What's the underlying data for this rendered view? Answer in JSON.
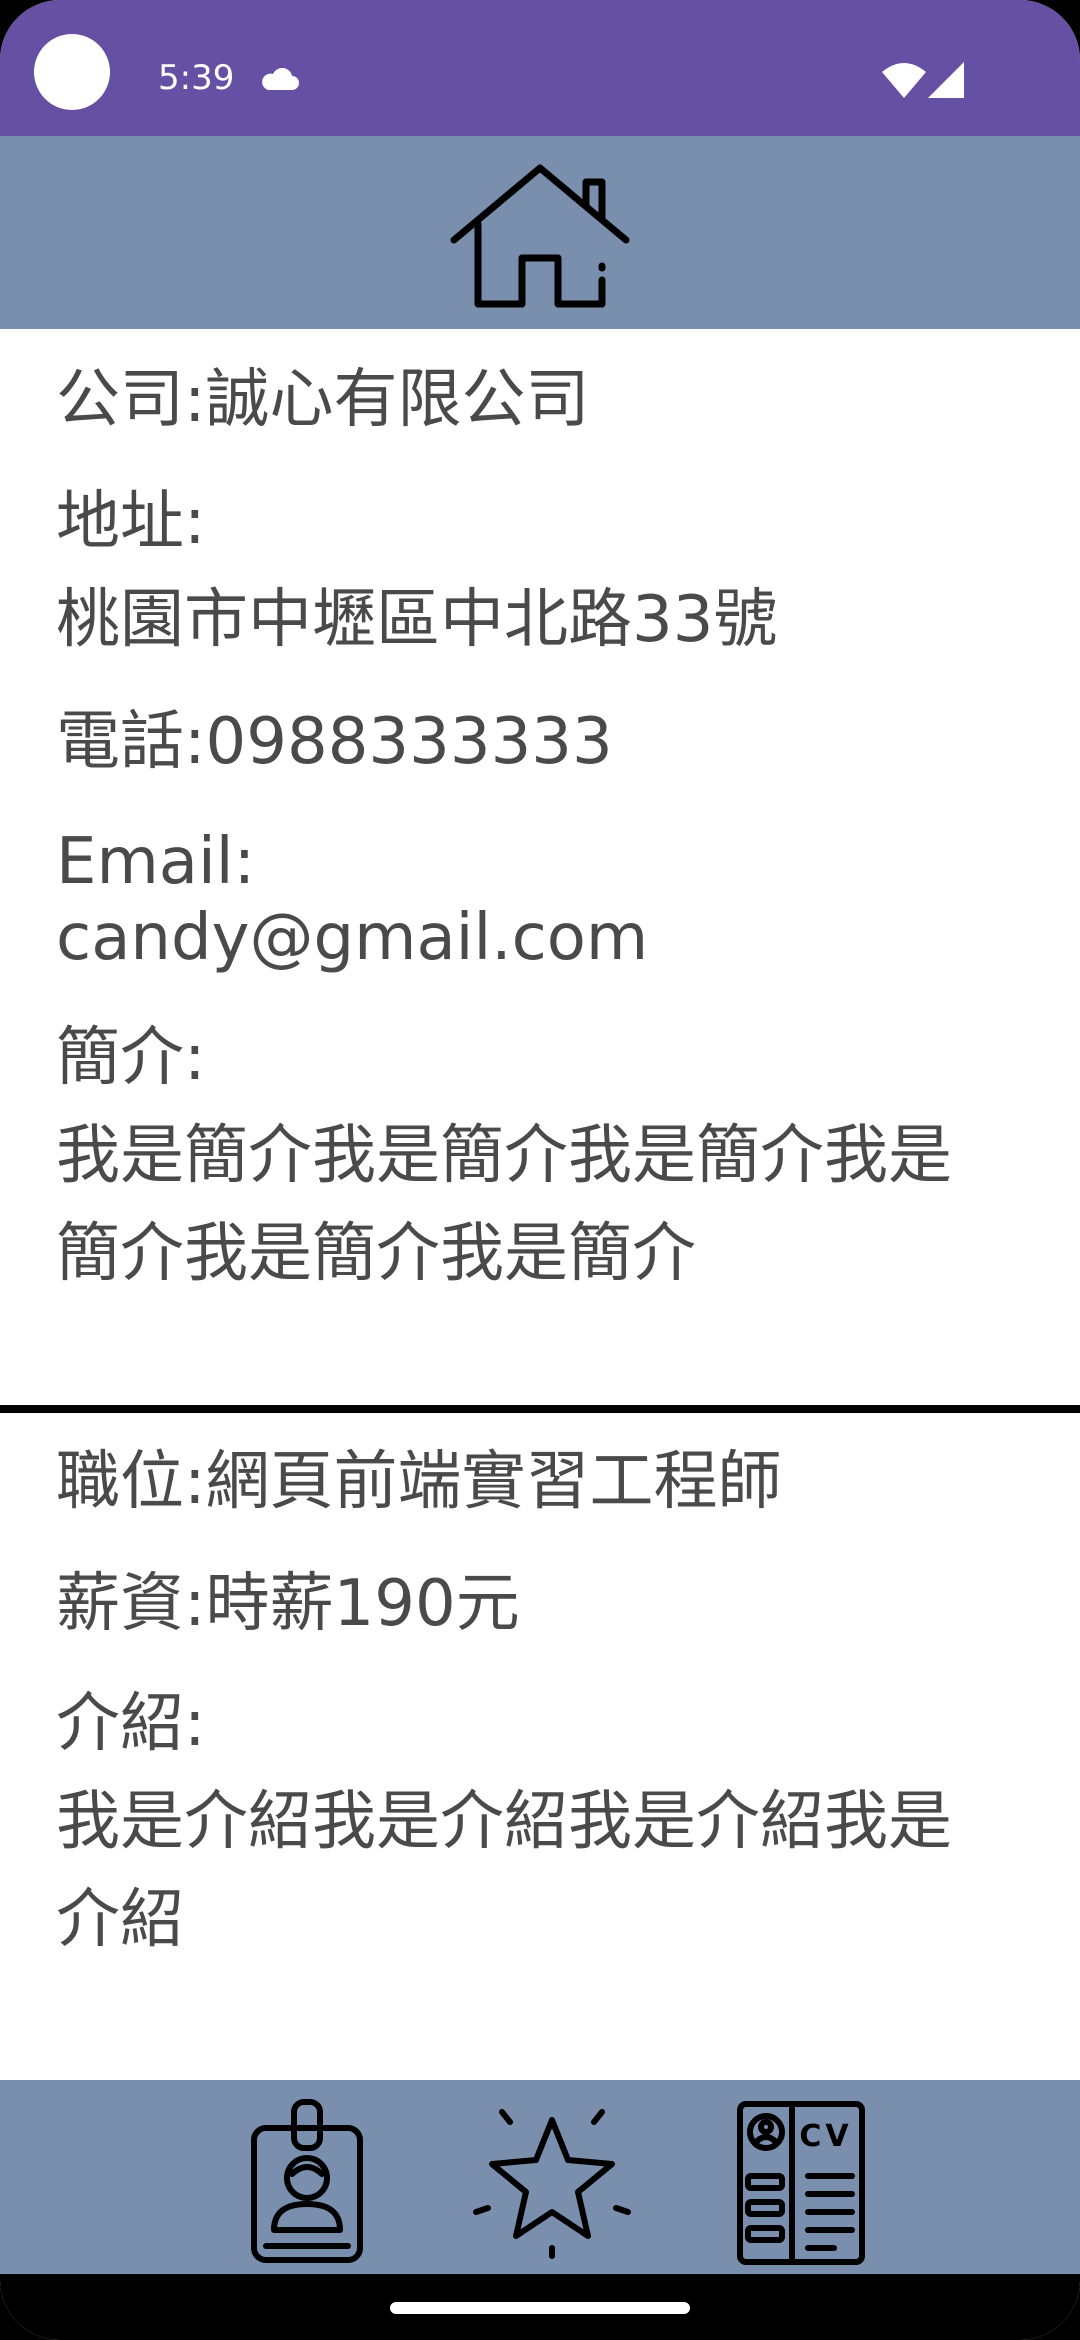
{
  "status_bar": {
    "time": "5:39",
    "icons": [
      "cloud-icon",
      "wifi-icon",
      "signal-icon"
    ]
  },
  "top_bar": {
    "icon": "home-icon"
  },
  "company": {
    "name_line": "公司:誠心有限公司",
    "address_label": "地址:",
    "address_value": "桃園市中壢區中北路33號",
    "phone_line": "電話:0988333333",
    "email_label": "Email:",
    "email_value": "candy@gmail.com",
    "intro_label": "簡介:",
    "intro_line1": "我是簡介我是簡介我是簡介我是",
    "intro_line2": "簡介我是簡介我是簡介"
  },
  "job": {
    "position_line": "職位:網頁前端實習工程師",
    "salary_line": "薪資:時薪190元",
    "desc_label": "介紹:",
    "desc_line1": "我是介紹我是介紹我是介紹我是",
    "desc_line2": "介紹"
  },
  "bottom_nav": {
    "items": [
      "id-badge-icon",
      "star-icon",
      "cv-resume-icon"
    ]
  },
  "colors": {
    "status_bar": "#6650a4",
    "app_bars": "#7a8fad",
    "text": "#4a4a4a"
  }
}
